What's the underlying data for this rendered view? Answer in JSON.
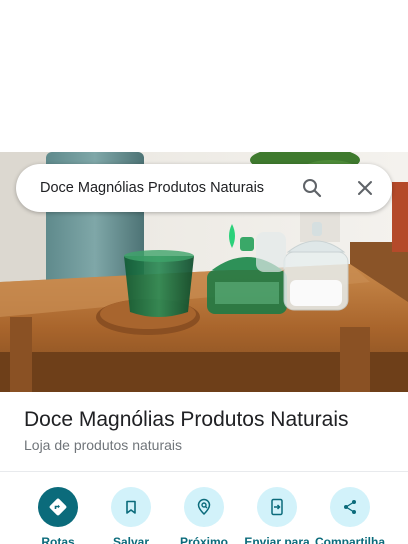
{
  "search": {
    "query": "Doce Magnólias Produtos Naturais"
  },
  "place": {
    "name": "Doce Magnólias Produtos Naturais",
    "category": "Loja de produtos naturais"
  },
  "actions": [
    {
      "label": "Rotas",
      "icon": "directions-icon"
    },
    {
      "label": "Salvar",
      "icon": "bookmark-icon"
    },
    {
      "label": "Próximo",
      "icon": "nearby-icon"
    },
    {
      "label": "Enviar para",
      "icon": "send-to-phone-icon"
    },
    {
      "label": "Compartilha",
      "icon": "share-icon"
    }
  ],
  "colors": {
    "accent": "#0b6b7b",
    "action_bg": "#d2f2fa",
    "text_primary": "#202124",
    "text_secondary": "#70757a"
  }
}
